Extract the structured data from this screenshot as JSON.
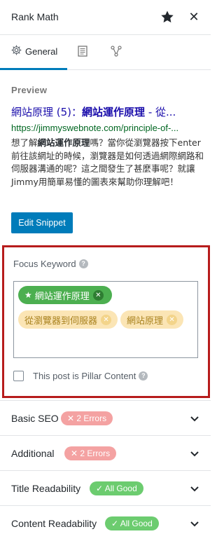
{
  "header": {
    "title": "Rank Math",
    "close_glyph": "✕",
    "icons": [
      "star-icon",
      "close-icon"
    ]
  },
  "tabs": [
    {
      "label": "General",
      "icon": "gear-icon",
      "active": true
    },
    {
      "label": "",
      "icon": "snippet-icon",
      "active": false
    },
    {
      "label": "",
      "icon": "schema-icon",
      "active": false
    }
  ],
  "preview": {
    "label": "Preview",
    "serp_title_pre": "網站原理 (5)：",
    "serp_title_bold": "網站運作原理",
    "serp_title_post": " - 從...",
    "serp_url": "https://jimmyswebnote.com/principle-of-...",
    "serp_desc_1": "想了解",
    "serp_desc_bold": "網站運作原理",
    "serp_desc_2": "嗎？當你從瀏覽器按下enter前往該網址的時候，瀏覽器是如何透過網際網路和伺服器溝通的呢？這之間發生了甚麼事呢？就讓Jimmy用簡單易懂的圖表來幫助你理解吧！",
    "edit_button": "Edit Snippet"
  },
  "focus_keyword": {
    "label": "Focus Keyword",
    "help_glyph": "?",
    "remove_glyph": "✕",
    "primary_glyph": "★",
    "keywords": [
      {
        "text": "網站運作原理",
        "primary": true
      },
      {
        "text": "從瀏覽器到伺服器",
        "primary": false
      },
      {
        "text": "網站原理",
        "primary": false
      }
    ],
    "pillar_label": "This post is Pillar Content",
    "pillar_checked": false
  },
  "sections": [
    {
      "title": "Basic SEO",
      "badge": "✕ 2 Errors",
      "status": "error"
    },
    {
      "title": "Additional",
      "badge": "✕ 2 Errors",
      "status": "error"
    },
    {
      "title": "Title Readability",
      "badge": "✓ All Good",
      "status": "good"
    },
    {
      "title": "Content Readability",
      "badge": "✓ All Good",
      "status": "good"
    }
  ],
  "colors": {
    "accent": "#007cba",
    "highlight_border": "#b71c1c",
    "error": "#f4a2a2",
    "good": "#6ccc6f",
    "primary_keyword": "#4caf50",
    "secondary_keyword": "#fbe5b5"
  }
}
